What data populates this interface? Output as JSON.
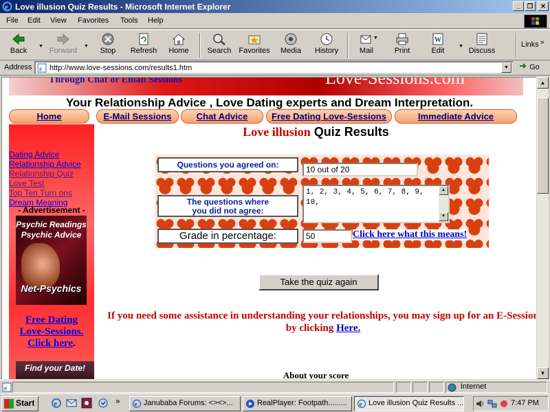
{
  "window": {
    "title": "Love illusion Quiz Results - Microsoft Internet Explorer",
    "controls": {
      "minimize": "_",
      "restore": "❐",
      "close": "✕"
    }
  },
  "menu": [
    "File",
    "Edit",
    "View",
    "Favorites",
    "Tools",
    "Help"
  ],
  "toolbar": {
    "back": "Back",
    "forward": "Forward",
    "stop": "Stop",
    "refresh": "Refresh",
    "home": "Home",
    "search": "Search",
    "favorites": "Favorites",
    "media": "Media",
    "history": "History",
    "mail": "Mail",
    "print": "Print",
    "edit": "Edit",
    "discuss": "Discuss",
    "links": "Links"
  },
  "address": {
    "label": "Address",
    "url": "http://www.love-sessions.com/results1.htm",
    "go": "Go"
  },
  "page": {
    "banner_left_1": "Through Chat or Email",
    "banner_left_2": "Sessions",
    "banner_right": "Love-Sessions.com",
    "headline": "Your Relationship Advice , Love Dating experts and Dream Interpretation.",
    "nav": [
      "Home",
      "E-Mail Sessions",
      "Chat Advice",
      "Free Dating Love-Sessions",
      "Immediate Advice"
    ],
    "sidebar_links": [
      "Dating Advice",
      "Relationship Advice",
      "Relationship Quiz",
      "Love Test",
      "Top Ten Turn ons",
      "Dream Meaning"
    ],
    "advertisement": "- Advertisement -",
    "psychic_ad": {
      "line1": "Psychic Readings",
      "line2": "Psychic Advice",
      "brand": "Net-Psychics"
    },
    "free_dating": {
      "line1": "Free Dating",
      "line2": "Love-Sessions.",
      "line3": "Click here",
      "dot": "."
    },
    "find_ad": "Find your Date!",
    "title_red": "Love illusion",
    "title_black": "Quiz Results",
    "results": {
      "agreed_label": "Questions you agreed on:",
      "agreed_value": "10 out of 20",
      "disagree_label_1": "The questions where",
      "disagree_label_2": "you did not agree:",
      "disagree_value": "1, 2, 3, 4, 5, 6, 7, 8, 9, 10,",
      "grade_label": "Grade in percentage:",
      "grade_value": "50",
      "meaning_link": "Click here what this means!"
    },
    "retake_button": "Take the quiz again",
    "help_text": "If you need some assistance in understanding your relationships, you may sign up for an E-Session by clicking",
    "help_link": "Here.",
    "about": "About your score"
  },
  "status": {
    "zone": "Internet"
  },
  "taskbar": {
    "start": "Start",
    "tasks": [
      "Janubaba Forums: <><>...",
      "RealPlayer: Footpath.........",
      "Love illusion Quiz Results ..."
    ],
    "clock": "7:47 PM"
  }
}
